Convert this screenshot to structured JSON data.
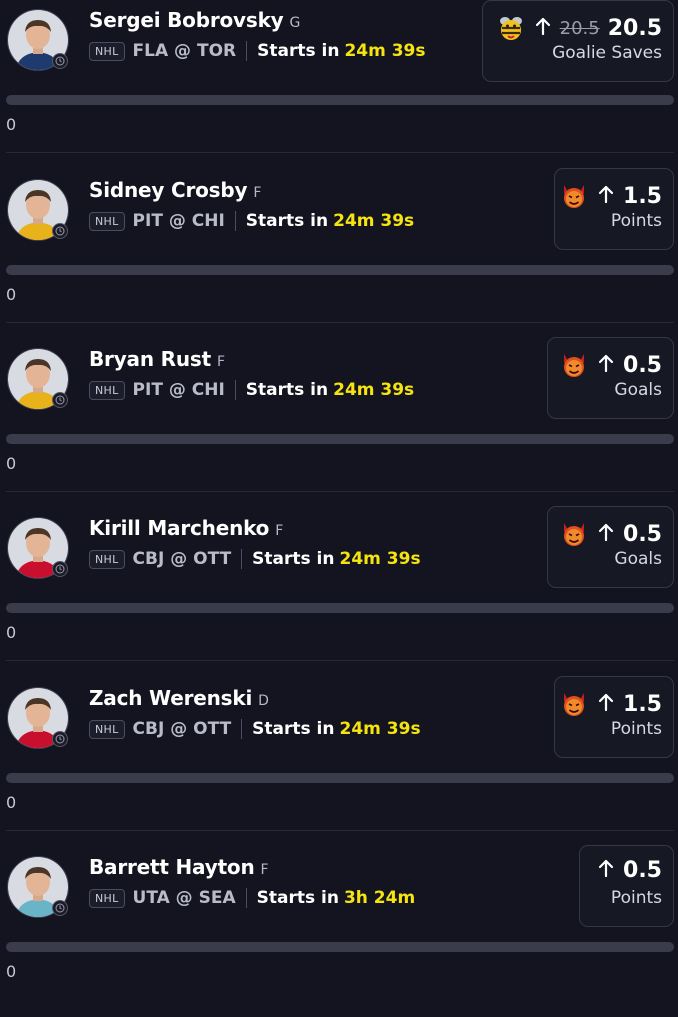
{
  "players": [
    {
      "name": "Sergei Bobrovsky",
      "position": "G",
      "league": "NHL",
      "matchup": "FLA @ TOR",
      "starts_label": "Starts in",
      "starts_time": "24m 39s",
      "line_old": "20.5",
      "line_value": "20.5",
      "stat": "Goalie Saves",
      "badge": "bee-emoji-icon",
      "count": "0"
    },
    {
      "name": "Sidney Crosby",
      "position": "F",
      "league": "NHL",
      "matchup": "PIT @ CHI",
      "starts_label": "Starts in",
      "starts_time": "24m 39s",
      "line_old": "",
      "line_value": "1.5",
      "stat": "Points",
      "badge": "devil-emoji-icon",
      "count": "0"
    },
    {
      "name": "Bryan Rust",
      "position": "F",
      "league": "NHL",
      "matchup": "PIT @ CHI",
      "starts_label": "Starts in",
      "starts_time": "24m 39s",
      "line_old": "",
      "line_value": "0.5",
      "stat": "Goals",
      "badge": "devil-emoji-icon",
      "count": "0"
    },
    {
      "name": "Kirill Marchenko",
      "position": "F",
      "league": "NHL",
      "matchup": "CBJ @ OTT",
      "starts_label": "Starts in",
      "starts_time": "24m 39s",
      "line_old": "",
      "line_value": "0.5",
      "stat": "Goals",
      "badge": "devil-emoji-icon",
      "count": "0"
    },
    {
      "name": "Zach Werenski",
      "position": "D",
      "league": "NHL",
      "matchup": "CBJ @ OTT",
      "starts_label": "Starts in",
      "starts_time": "24m 39s",
      "line_old": "",
      "line_value": "1.5",
      "stat": "Points",
      "badge": "devil-emoji-icon",
      "count": "0"
    },
    {
      "name": "Barrett Hayton",
      "position": "F",
      "league": "NHL",
      "matchup": "UTA @ SEA",
      "starts_label": "Starts in",
      "starts_time": "3h 24m",
      "line_old": "",
      "line_value": "0.5",
      "stat": "Points",
      "badge": "",
      "count": "0"
    }
  ],
  "colors": {
    "background": "#13141f",
    "accent_time": "#f5e40f",
    "card_border": "#34374a",
    "bar": "#3a3c4c"
  },
  "icons": {
    "arrow": "arrow-up-icon",
    "clock": "clock-icon"
  }
}
